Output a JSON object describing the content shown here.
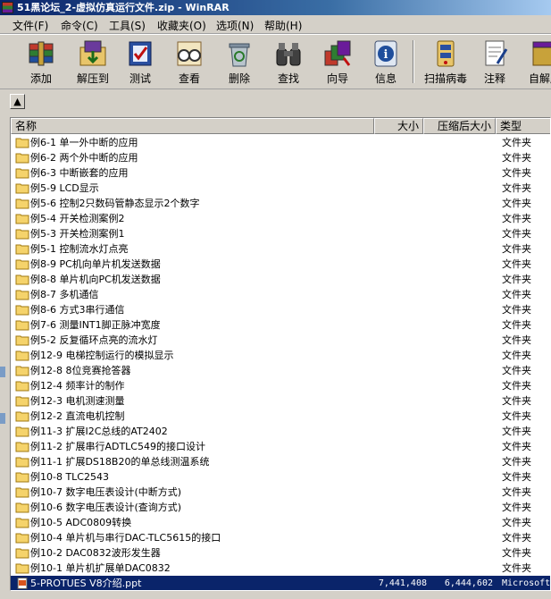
{
  "window": {
    "title": "51黑论坛_2-虚拟仿真运行文件.zip - WinRAR"
  },
  "menu": [
    {
      "label": "文件(F)"
    },
    {
      "label": "命令(C)"
    },
    {
      "label": "工具(S)"
    },
    {
      "label": "收藏夹(O)"
    },
    {
      "label": "选项(N)"
    },
    {
      "label": "帮助(H)"
    }
  ],
  "toolbar": [
    {
      "label": "添加",
      "icon": "books-stack-icon"
    },
    {
      "label": "解压到",
      "icon": "extract-folder-icon"
    },
    {
      "label": "测试",
      "icon": "test-checkmark-icon"
    },
    {
      "label": "查看",
      "icon": "view-glasses-icon"
    },
    {
      "label": "删除",
      "icon": "recycle-bin-icon"
    },
    {
      "label": "查找",
      "icon": "binoculars-icon"
    },
    {
      "label": "向导",
      "icon": "wizard-icon"
    },
    {
      "label": "信息",
      "icon": "info-icon"
    },
    {
      "label": "扫描病毒",
      "icon": "virus-scan-icon"
    },
    {
      "label": "注释",
      "icon": "comment-icon"
    },
    {
      "label": "自解压",
      "icon": "sfx-icon"
    }
  ],
  "columns": {
    "name": "名称",
    "size": "大小",
    "packed": "压缩后大小",
    "type": "类型"
  },
  "files": [
    {
      "name": "例6-1 单一外中断的应用",
      "size": "",
      "packed": "",
      "type": "文件夹"
    },
    {
      "name": "例6-2 两个外中断的应用",
      "size": "",
      "packed": "",
      "type": "文件夹"
    },
    {
      "name": "例6-3 中断嵌套的应用",
      "size": "",
      "packed": "",
      "type": "文件夹"
    },
    {
      "name": "例5-9  LCD显示",
      "size": "",
      "packed": "",
      "type": "文件夹"
    },
    {
      "name": "例5-6 控制2只数码管静态显示2个数字",
      "size": "",
      "packed": "",
      "type": "文件夹"
    },
    {
      "name": "例5-4 开关检测案例2",
      "size": "",
      "packed": "",
      "type": "文件夹"
    },
    {
      "name": "例5-3 开关检测案例1",
      "size": "",
      "packed": "",
      "type": "文件夹"
    },
    {
      "name": "例5-1 控制流水灯点亮",
      "size": "",
      "packed": "",
      "type": "文件夹"
    },
    {
      "name": "例8-9  PC机向单片机发送数据",
      "size": "",
      "packed": "",
      "type": "文件夹"
    },
    {
      "name": "例8-8  单片机向PC机发送数据",
      "size": "",
      "packed": "",
      "type": "文件夹"
    },
    {
      "name": "例8-7  多机通信",
      "size": "",
      "packed": "",
      "type": "文件夹"
    },
    {
      "name": "例8-6 方式3串行通信",
      "size": "",
      "packed": "",
      "type": "文件夹"
    },
    {
      "name": "例7-6 测量INT1脚正脉冲宽度",
      "size": "",
      "packed": "",
      "type": "文件夹"
    },
    {
      "name": "例5-2 反复循环点亮的流水灯",
      "size": "",
      "packed": "",
      "type": "文件夹"
    },
    {
      "name": "例12-9 电梯控制运行的模拟显示",
      "size": "",
      "packed": "",
      "type": "文件夹"
    },
    {
      "name": "例12-8 8位竞赛抢答器",
      "size": "",
      "packed": "",
      "type": "文件夹"
    },
    {
      "name": "例12-4 频率计的制作",
      "size": "",
      "packed": "",
      "type": "文件夹"
    },
    {
      "name": "例12-3 电机测速测量",
      "size": "",
      "packed": "",
      "type": "文件夹"
    },
    {
      "name": "例12-2 直流电机控制",
      "size": "",
      "packed": "",
      "type": "文件夹"
    },
    {
      "name": "例11-3 扩展I2C总线的AT2402",
      "size": "",
      "packed": "",
      "type": "文件夹"
    },
    {
      "name": "例11-2 扩展串行ADTLC549的接口设计",
      "size": "",
      "packed": "",
      "type": "文件夹"
    },
    {
      "name": "例11-1 扩展DS18B20的单总线测温系统",
      "size": "",
      "packed": "",
      "type": "文件夹"
    },
    {
      "name": "例10-8 TLC2543",
      "size": "",
      "packed": "",
      "type": "文件夹"
    },
    {
      "name": "例10-7 数字电压表设计(中断方式)",
      "size": "",
      "packed": "",
      "type": "文件夹"
    },
    {
      "name": "例10-6 数字电压表设计(查询方式)",
      "size": "",
      "packed": "",
      "type": "文件夹"
    },
    {
      "name": "例10-5 ADC0809转换",
      "size": "",
      "packed": "",
      "type": "文件夹"
    },
    {
      "name": "例10-4 单片机与串行DAC-TLC5615的接口",
      "size": "",
      "packed": "",
      "type": "文件夹"
    },
    {
      "name": "例10-2  DAC0832波形发生器",
      "size": "",
      "packed": "",
      "type": "文件夹"
    },
    {
      "name": "例10-1 单片机扩展单DAC0832",
      "size": "",
      "packed": "",
      "type": "文件夹"
    },
    {
      "name": "5-PROTUES V8介绍.ppt",
      "size": "7,441,408",
      "packed": "6,444,602",
      "type": "Microsoft",
      "selected": true
    }
  ]
}
